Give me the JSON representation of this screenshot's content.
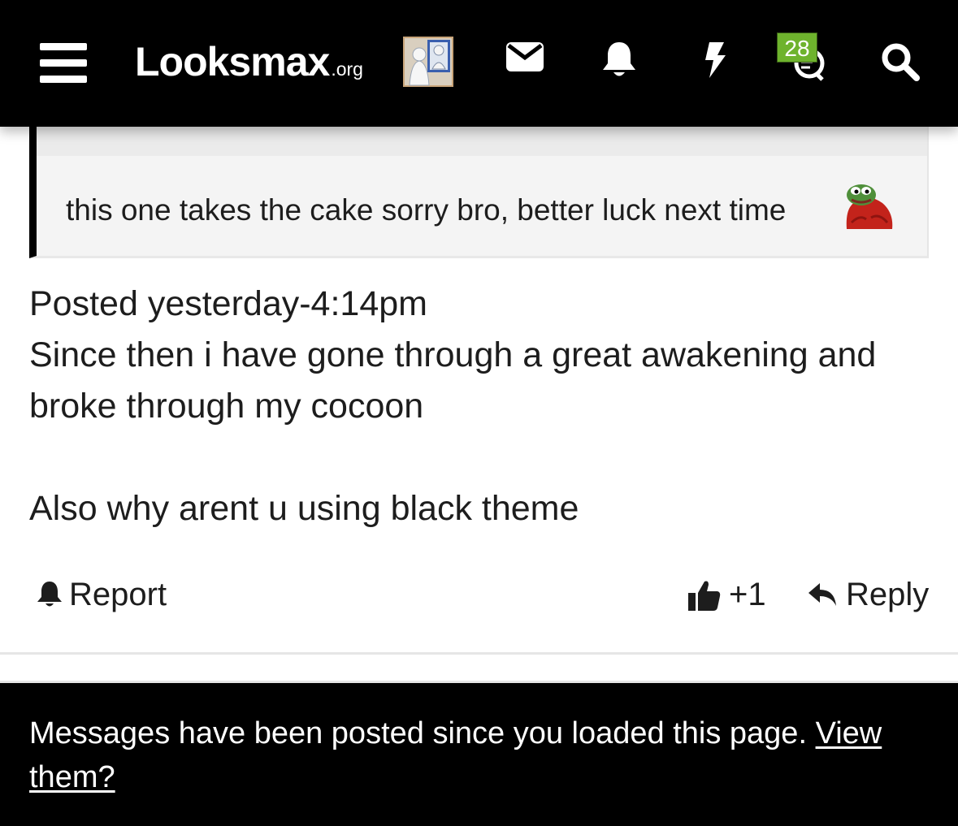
{
  "header": {
    "logo_main": "Looksmax",
    "logo_tld": ".org",
    "icons": [
      "menu-icon",
      "user-avatar",
      "mail-icon",
      "bell-icon",
      "bolt-icon",
      "conversations-icon",
      "search-icon"
    ],
    "conversations_badge": "28",
    "badge_color": "#6eb32d"
  },
  "quote": {
    "text": "this one takes the cake sorry bro, better luck next time",
    "emoji": "pepe-blanket-emoji"
  },
  "post": {
    "line1": "Posted yesterday-4:14pm",
    "line2": "Since then i have gone through a great awakening and broke through my cocoon",
    "line3": "Also why arent u using black theme"
  },
  "actions": {
    "report_label": "Report",
    "like_label": "+1",
    "reply_label": "Reply"
  },
  "notice": {
    "text": "Messages have been posted since you loaded this page.",
    "link": "View them?"
  }
}
